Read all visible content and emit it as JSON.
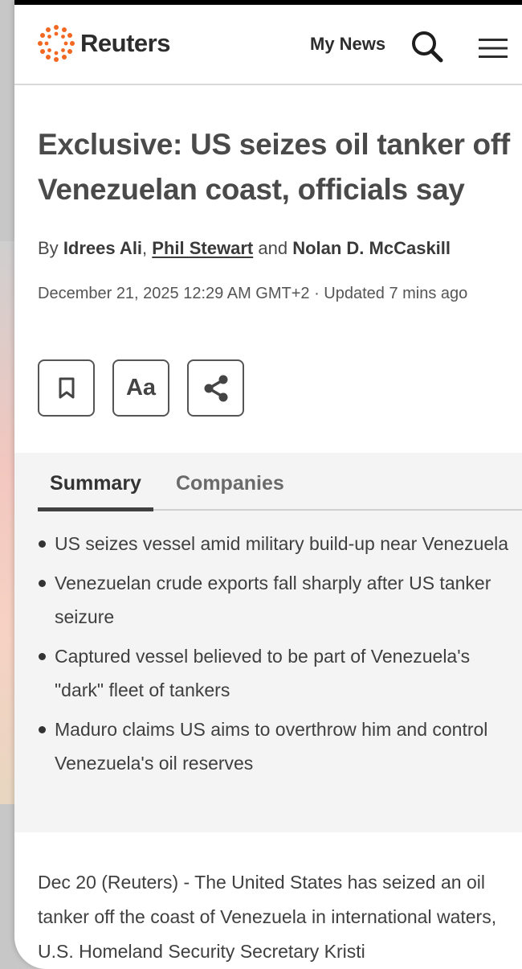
{
  "header": {
    "brand": "Reuters",
    "my_news": "My News",
    "brand_color": "#f26722"
  },
  "article": {
    "headline": "Exclusive: US seizes oil tanker off Venezuelan coast, officials say",
    "byline": {
      "prefix": "By",
      "authors": [
        "Idrees Ali",
        "Phil Stewart",
        "Nolan D. McCaskill"
      ],
      "separator": ",",
      "conjunction": "and"
    },
    "dateline": "December 21, 2025 12:29 AM GMT+2 · Updated 7 mins ago",
    "actions": {
      "bookmark_icon": "bookmark-icon",
      "text_size_label": "Aa",
      "share_icon": "share-icon"
    },
    "tabs": [
      {
        "label": "Summary",
        "active": true
      },
      {
        "label": "Companies",
        "active": false
      }
    ],
    "summary": [
      "US seizes vessel amid military build-up near Venezuela",
      "Venezuelan crude exports fall sharply after US tanker seizure",
      "Captured vessel believed to be part of Venezuela's \"dark\" fleet of tankers",
      "Maduro claims US aims to overthrow him and control Venezuela's oil reserves"
    ],
    "body_text": "Dec 20 (Reuters) - The United States has seized an oil tanker off the coast of Venezuela in international waters, U.S. Homeland Security Secretary Kristi"
  }
}
